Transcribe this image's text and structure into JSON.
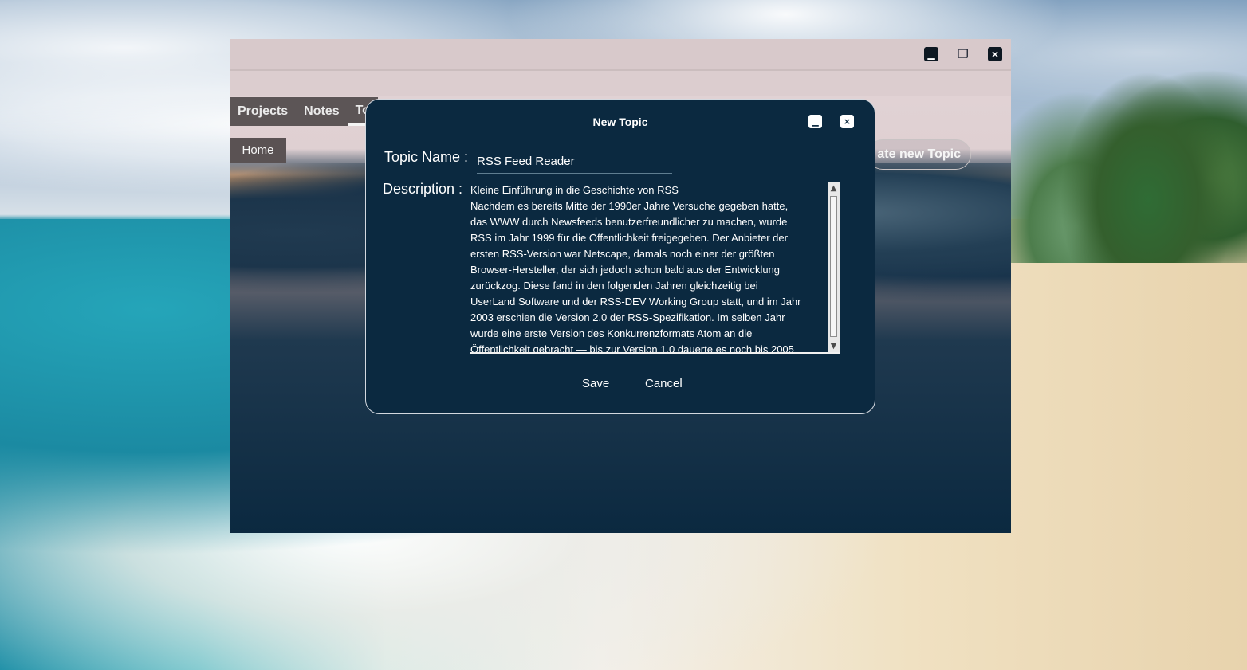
{
  "main_window": {
    "tabs": [
      "Projects",
      "Notes",
      "To"
    ],
    "home_button": "Home",
    "create_topic_button": "ate new Topic"
  },
  "dialog": {
    "title": "New Topic",
    "topic_label": "Topic Name :",
    "topic_value": "RSS Feed Reader",
    "description_label": "Description :",
    "description_value": "Kleine Einführung in die Geschichte von RSS\nNachdem es bereits Mitte der 1990er Jahre Versuche gegeben hatte,\ndas WWW durch Newsfeeds benutzerfreundlicher zu machen, wurde\nRSS im Jahr 1999 für die Öffentlichkeit freigegeben. Der Anbieter der\nersten RSS-Version war Netscape, damals noch einer der größten\nBrowser-Hersteller, der sich jedoch schon bald aus der Entwicklung\nzurückzog. Diese fand in den folgenden Jahren gleichzeitig bei\nUserLand Software und der RSS-DEV Working Group statt, und im Jahr\n2003 erschien die Version 2.0 der RSS-Spezifikation. Im selben Jahr\nwurde eine erste Version des Konkurrenzformats Atom an die\nÖffentlichkeit gebracht — bis zur Version 1.0 dauerte es noch bis 2005",
    "save_label": "Save",
    "cancel_label": "Cancel"
  },
  "icons": {
    "minimize": "minimize-icon",
    "restore": "restore-icon",
    "close": "close-icon",
    "scroll_up": "chevron-up-icon",
    "scroll_down": "chevron-down-icon"
  },
  "colors": {
    "dialog_bg": "#0b2940",
    "window_titlebar": "#d8c9cb",
    "tab_bg": "#5c5556"
  }
}
